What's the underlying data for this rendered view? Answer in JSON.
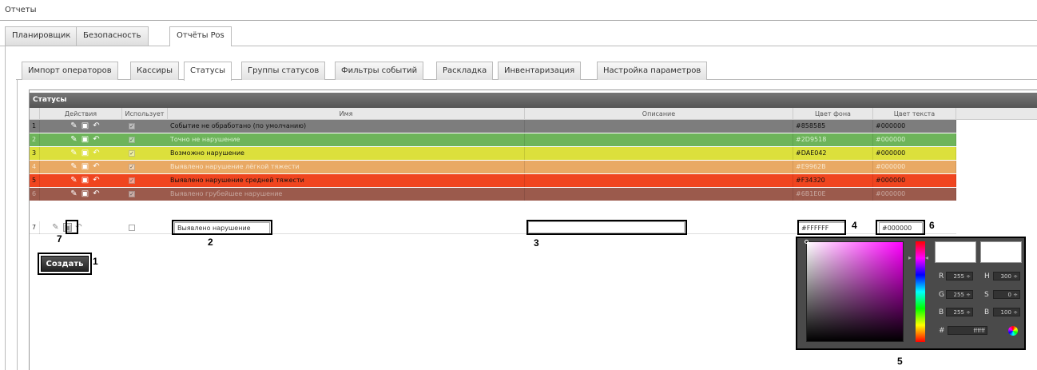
{
  "menu": {
    "title": "Отчеты"
  },
  "tabs1": [
    "Планировщик",
    "Безопасность",
    "Отчёты Pos"
  ],
  "tabs2": [
    "Импорт операторов",
    "Кассиры",
    "Статусы",
    "Группы статусов",
    "Фильтры событий",
    "Раскладка",
    "Инвентаризация",
    "Настройка параметров"
  ],
  "grid": {
    "title": "Статусы",
    "columns": [
      "Действия",
      "Использует",
      "Имя",
      "Описание",
      "Цвет фона",
      "Цвет текста"
    ],
    "rows": [
      {
        "n": "1",
        "name": "Событие не обработано (по умолчанию)",
        "bg": "#858585",
        "fg": "#000000"
      },
      {
        "n": "2",
        "name": "Точно не нарушение",
        "bg": "#2D9518",
        "fg": "#000000"
      },
      {
        "n": "3",
        "name": "Возможно нарушение",
        "bg": "#DAE042",
        "fg": "#000000"
      },
      {
        "n": "4",
        "name": "Выявлено нарушение лёгкой тяжести",
        "bg": "#E9962B",
        "fg": "#000000"
      },
      {
        "n": "5",
        "name": "Выявлено нарушение средней тяжести",
        "bg": "#F34320",
        "fg": "#000000"
      },
      {
        "n": "6",
        "name": "Выявлено грубейшее нарушение",
        "bg": "#6B1E0E",
        "fg": "#000000"
      }
    ],
    "row_colors": [
      "#7d7d7d",
      "#6db45a",
      "#dce03c",
      "#e9a964",
      "#f0451f",
      "#9b5a4c"
    ],
    "row_text_colors": [
      "#111111",
      "#d8f0d0",
      "#111111",
      "#f8e8d0",
      "#111111",
      "#c8a8a0"
    ],
    "new_row": {
      "n": "7",
      "name_value": "Выявлено нарушение",
      "description_value": "",
      "bg_value": "#FFFFFF",
      "fg_value": "#000000"
    }
  },
  "create_button": "Создать",
  "callouts": [
    "1",
    "2",
    "3",
    "4",
    "5",
    "6",
    "7"
  ],
  "picker": {
    "r": "255",
    "g": "255",
    "b": "255",
    "h": "300",
    "s": "0",
    "bv": "100",
    "hex": "ffffff",
    "labels": {
      "r": "R",
      "g": "G",
      "b": "B",
      "h": "H",
      "s": "S",
      "bb": "B",
      "hash": "#"
    }
  }
}
